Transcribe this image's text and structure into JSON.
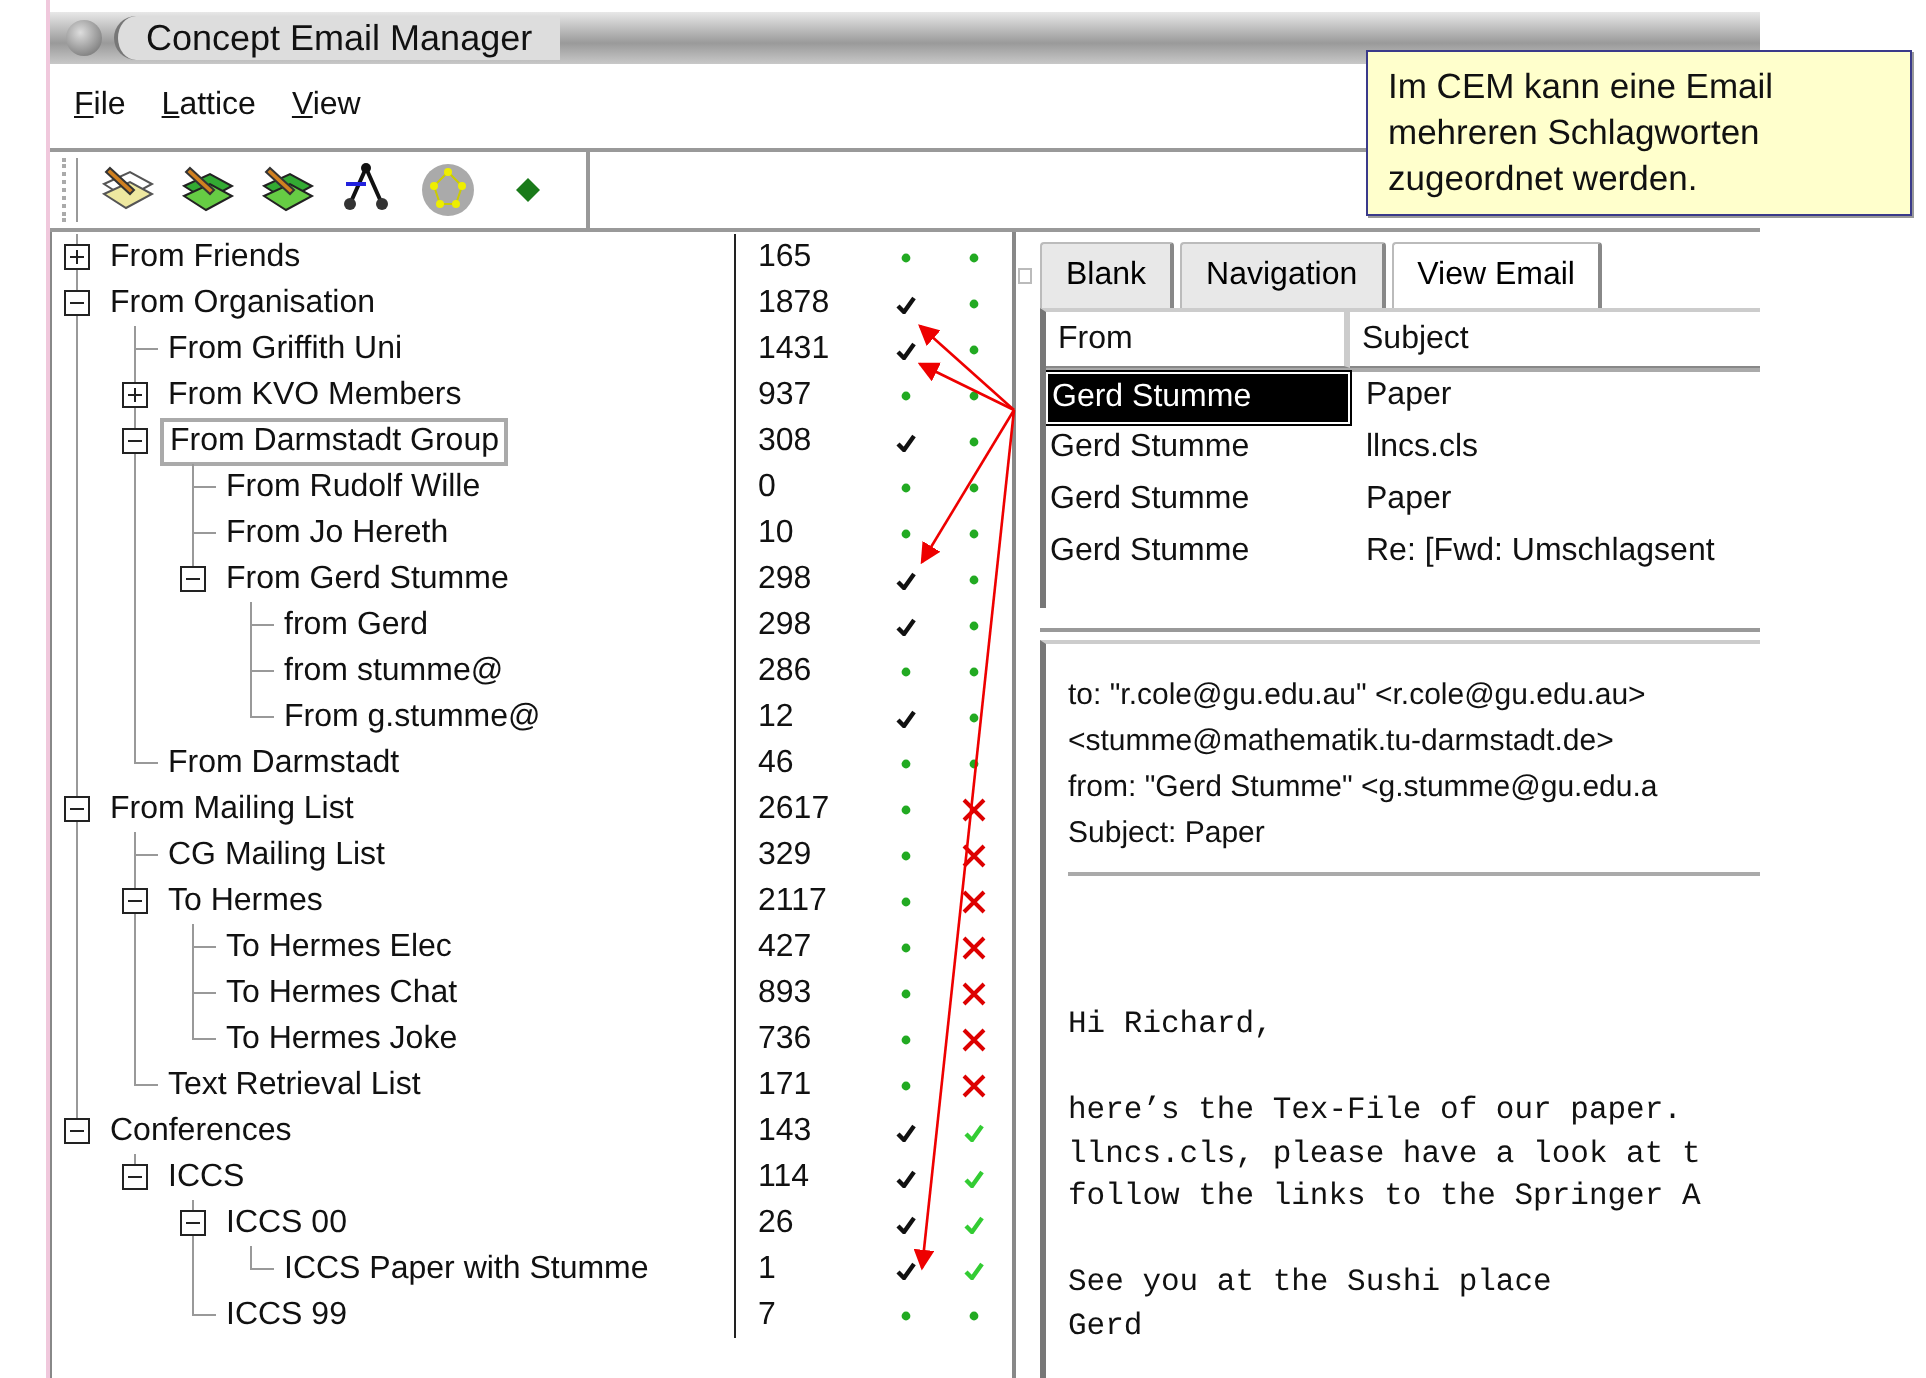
{
  "window": {
    "title": "Concept Email Manager"
  },
  "menu": [
    "File",
    "Lattice",
    "View"
  ],
  "tree": [
    {
      "label": "From Friends",
      "count": "165",
      "marks": [
        {
          "kind": "dot"
        },
        {
          "kind": "dot"
        }
      ],
      "expanded": false,
      "selected": false
    },
    {
      "label": "From Organisation",
      "count": "1878",
      "marks": [
        {
          "kind": "tick"
        },
        {
          "kind": "dot"
        }
      ],
      "expanded": true,
      "selected": false,
      "children": [
        {
          "label": "From Griffith Uni",
          "count": "1431",
          "marks": [
            {
              "kind": "tick"
            },
            {
              "kind": "dot"
            }
          ],
          "selected": false
        },
        {
          "label": "From KVO Members",
          "count": "937",
          "marks": [
            {
              "kind": "dot"
            },
            {
              "kind": "dot"
            }
          ],
          "expanded": false,
          "selected": false
        },
        {
          "label": "From Darmstadt Group",
          "count": "308",
          "marks": [
            {
              "kind": "tick"
            },
            {
              "kind": "dot"
            }
          ],
          "expanded": true,
          "selected": true,
          "children": [
            {
              "label": "From Rudolf Wille",
              "count": "0",
              "marks": [
                {
                  "kind": "dot"
                },
                {
                  "kind": "dot"
                }
              ],
              "selected": false
            },
            {
              "label": "From Jo Hereth",
              "count": "10",
              "marks": [
                {
                  "kind": "dot"
                },
                {
                  "kind": "dot"
                }
              ],
              "selected": false
            },
            {
              "label": "From Gerd Stumme",
              "count": "298",
              "marks": [
                {
                  "kind": "tick"
                },
                {
                  "kind": "dot"
                }
              ],
              "expanded": true,
              "selected": false,
              "children": [
                {
                  "label": "from Gerd",
                  "count": "298",
                  "marks": [
                    {
                      "kind": "tick"
                    },
                    {
                      "kind": "dot"
                    }
                  ],
                  "selected": false
                },
                {
                  "label": "from stumme@",
                  "count": "286",
                  "marks": [
                    {
                      "kind": "dot"
                    },
                    {
                      "kind": "dot"
                    }
                  ],
                  "selected": false
                },
                {
                  "label": "From g.stumme@",
                  "count": "12",
                  "marks": [
                    {
                      "kind": "tick"
                    },
                    {
                      "kind": "dot"
                    }
                  ],
                  "selected": false
                }
              ]
            }
          ]
        },
        {
          "label": "From Darmstadt",
          "count": "46",
          "marks": [
            {
              "kind": "dot"
            },
            {
              "kind": "dot"
            }
          ],
          "selected": false
        }
      ]
    },
    {
      "label": "From Mailing List",
      "count": "2617",
      "marks": [
        {
          "kind": "dot"
        },
        {
          "kind": "cross"
        }
      ],
      "expanded": true,
      "selected": false,
      "children": [
        {
          "label": "CG Mailing List",
          "count": "329",
          "marks": [
            {
              "kind": "dot"
            },
            {
              "kind": "cross"
            }
          ],
          "selected": false
        },
        {
          "label": "To Hermes",
          "count": "2117",
          "marks": [
            {
              "kind": "dot"
            },
            {
              "kind": "cross"
            }
          ],
          "expanded": true,
          "selected": false,
          "children": [
            {
              "label": "To Hermes Elec",
              "count": "427",
              "marks": [
                {
                  "kind": "dot"
                },
                {
                  "kind": "cross"
                }
              ],
              "selected": false
            },
            {
              "label": "To Hermes Chat",
              "count": "893",
              "marks": [
                {
                  "kind": "dot"
                },
                {
                  "kind": "cross"
                }
              ],
              "selected": false
            },
            {
              "label": "To Hermes Joke",
              "count": "736",
              "marks": [
                {
                  "kind": "dot"
                },
                {
                  "kind": "cross"
                }
              ],
              "selected": false
            }
          ]
        },
        {
          "label": "Text Retrieval List",
          "count": "171",
          "marks": [
            {
              "kind": "dot"
            },
            {
              "kind": "cross"
            }
          ],
          "selected": false
        }
      ]
    },
    {
      "label": "Conferences",
      "count": "143",
      "marks": [
        {
          "kind": "tick"
        },
        {
          "kind": "green-tick"
        }
      ],
      "expanded": true,
      "selected": false,
      "children": [
        {
          "label": "ICCS",
          "count": "114",
          "marks": [
            {
              "kind": "tick"
            },
            {
              "kind": "green-tick"
            }
          ],
          "expanded": true,
          "selected": false,
          "children": [
            {
              "label": "ICCS 00",
              "count": "26",
              "marks": [
                {
                  "kind": "tick"
                },
                {
                  "kind": "green-tick"
                }
              ],
              "expanded": true,
              "selected": false,
              "children": [
                {
                  "label": "ICCS Paper with Stumme",
                  "count": "1",
                  "marks": [
                    {
                      "kind": "tick"
                    },
                    {
                      "kind": "green-tick"
                    }
                  ],
                  "selected": false
                }
              ]
            },
            {
              "label": "ICCS 99",
              "count": "7",
              "marks": [
                {
                  "kind": "dot"
                },
                {
                  "kind": "dot"
                }
              ],
              "selected": false
            }
          ]
        }
      ]
    }
  ],
  "tabs": [
    {
      "label": "Blank",
      "selected": false
    },
    {
      "label": "Navigation",
      "selected": false
    },
    {
      "label": "View Email",
      "selected": true
    }
  ],
  "email_list": {
    "columns": [
      "From",
      "Subject"
    ],
    "rows": [
      {
        "from": "Gerd Stumme",
        "subject": "Paper",
        "selected": true
      },
      {
        "from": "Gerd Stumme",
        "subject": "llncs.cls",
        "selected": false
      },
      {
        "from": "Gerd Stumme",
        "subject": "Paper",
        "selected": false
      },
      {
        "from": "Gerd Stumme",
        "subject": "Re: [Fwd: Umschlagsent",
        "selected": false
      }
    ]
  },
  "email": {
    "headers": [
      "to: \"r.cole@gu.edu.au\" <r.cole@gu.edu.au>",
      "<stumme@mathematik.tu-darmstadt.de>",
      "from: \"Gerd Stumme\" <g.stumme@gu.edu.a",
      "Subject: Paper"
    ],
    "paragraphs": [
      [
        "Hi Richard,"
      ],
      [
        "here’s the Tex-File of our paper.",
        "llncs.cls, please have a look at t",
        "follow the links to the Springer A"
      ],
      [
        "See you at the Sushi place",
        "Gerd"
      ]
    ]
  },
  "annotation": {
    "text": "Im CEM kann eine Email mehreren Schlagworten zugeordnet werden."
  }
}
